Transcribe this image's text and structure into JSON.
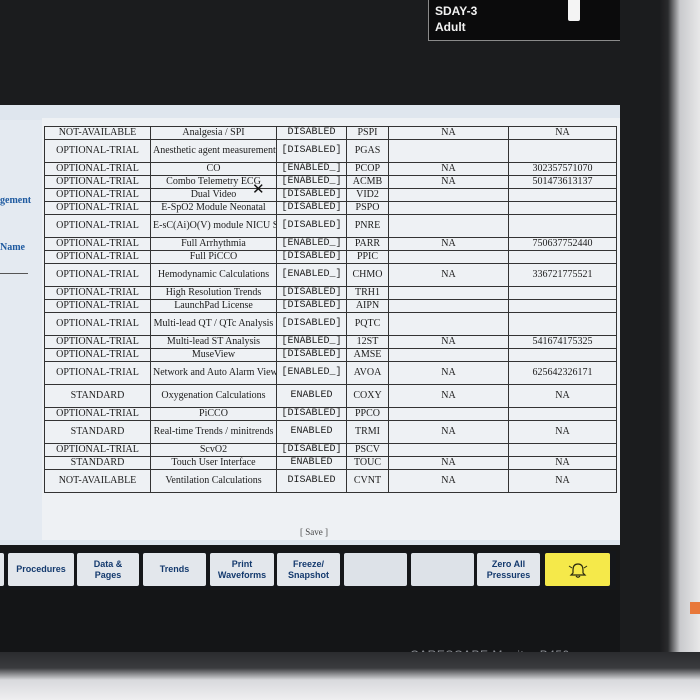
{
  "patient": {
    "line1": "SDAY-3",
    "line2": "Adult"
  },
  "left_panel": {
    "label1": "gement",
    "label2": "Name"
  },
  "table_rows": [
    {
      "status": "NOT-AVAILABLE",
      "name": "Analgesia / SPI",
      "enabled": "DISABLED",
      "code": "PSPI",
      "na": "NA",
      "key": "NA"
    },
    {
      "status": "OPTIONAL-TRIAL",
      "name": "Anesthetic agent measurement",
      "enabled": "[DISABLED]",
      "code": "PGAS",
      "na": "",
      "key": ""
    },
    {
      "status": "OPTIONAL-TRIAL",
      "name": "CO",
      "enabled": "[ENABLED_]",
      "code": "PCOP",
      "na": "NA",
      "key": "302357571070"
    },
    {
      "status": "OPTIONAL-TRIAL",
      "name": "Combo Telemetry ECG",
      "enabled": "[ENABLED_]",
      "code": "ACMB",
      "na": "NA",
      "key": "501473613137"
    },
    {
      "status": "OPTIONAL-TRIAL",
      "name": "Dual Video",
      "enabled": "[DISABLED]",
      "code": "VID2",
      "na": "",
      "key": ""
    },
    {
      "status": "OPTIONAL-TRIAL",
      "name": "E-SpO2 Module Neonatal",
      "enabled": "[DISABLED]",
      "code": "PSPO",
      "na": "",
      "key": ""
    },
    {
      "status": "OPTIONAL-TRIAL",
      "name": "E-sC(Ai)O(V) module NICU SW",
      "enabled": "[DISABLED]",
      "code": "PNRE",
      "na": "",
      "key": ""
    },
    {
      "status": "OPTIONAL-TRIAL",
      "name": "Full Arrhythmia",
      "enabled": "[ENABLED_]",
      "code": "PARR",
      "na": "NA",
      "key": "750637752440"
    },
    {
      "status": "OPTIONAL-TRIAL",
      "name": "Full PiCCO",
      "enabled": "[DISABLED]",
      "code": "PPIC",
      "na": "",
      "key": ""
    },
    {
      "status": "OPTIONAL-TRIAL",
      "name": "Hemodynamic Calculations",
      "enabled": "[ENABLED_]",
      "code": "CHMO",
      "na": "NA",
      "key": "336721775521"
    },
    {
      "status": "OPTIONAL-TRIAL",
      "name": "High Resolution Trends",
      "enabled": "[DISABLED]",
      "code": "TRH1",
      "na": "",
      "key": ""
    },
    {
      "status": "OPTIONAL-TRIAL",
      "name": "LaunchPad License",
      "enabled": "[DISABLED]",
      "code": "AIPN",
      "na": "",
      "key": ""
    },
    {
      "status": "OPTIONAL-TRIAL",
      "name": "Multi-lead QT / QTc Analysis",
      "enabled": "[DISABLED]",
      "code": "PQTC",
      "na": "",
      "key": ""
    },
    {
      "status": "OPTIONAL-TRIAL",
      "name": "Multi-lead ST Analysis",
      "enabled": "[ENABLED_]",
      "code": "12ST",
      "na": "NA",
      "key": "541674175325"
    },
    {
      "status": "OPTIONAL-TRIAL",
      "name": "MuseView",
      "enabled": "[DISABLED]",
      "code": "AMSE",
      "na": "",
      "key": ""
    },
    {
      "status": "OPTIONAL-TRIAL",
      "name": "Network and Auto Alarm View",
      "enabled": "[ENABLED_]",
      "code": "AVOA",
      "na": "NA",
      "key": "625642326171"
    },
    {
      "status": "STANDARD",
      "name": "Oxygenation Calculations",
      "enabled": "ENABLED",
      "code": "COXY",
      "na": "NA",
      "key": "NA"
    },
    {
      "status": "OPTIONAL-TRIAL",
      "name": "PiCCO",
      "enabled": "[DISABLED]",
      "code": "PPCO",
      "na": "",
      "key": ""
    },
    {
      "status": "STANDARD",
      "name": "Real-time Trends / minitrends",
      "enabled": "ENABLED",
      "code": "TRMI",
      "na": "NA",
      "key": "NA"
    },
    {
      "status": "OPTIONAL-TRIAL",
      "name": "ScvO2",
      "enabled": "[DISABLED]",
      "code": "PSCV",
      "na": "",
      "key": ""
    },
    {
      "status": "STANDARD",
      "name": "Touch User Interface",
      "enabled": "ENABLED",
      "code": "TOUC",
      "na": "NA",
      "key": "NA"
    },
    {
      "status": "NOT-AVAILABLE",
      "name": "Ventilation Calculations",
      "enabled": "DISABLED",
      "code": "CVNT",
      "na": "NA",
      "key": "NA"
    }
  ],
  "save_link": "[ Save ]",
  "buttons": {
    "procedures": "Procedures",
    "data_pages": "Data &\nPages",
    "trends": "Trends",
    "print_waveforms": "Print\nWaveforms",
    "freeze_snapshot": "Freeze/\nSnapshot",
    "zero_all": "Zero All\nPressures"
  },
  "alarm_icon": "bell-icon",
  "brand": "CARESCAPE Monitor B450"
}
